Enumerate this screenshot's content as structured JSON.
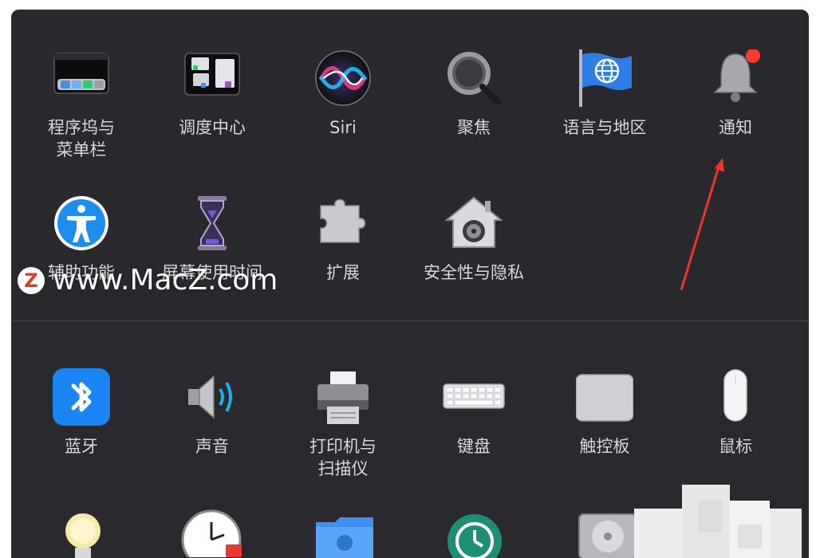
{
  "watermark": {
    "text": "www.MacZ.com",
    "badge": "Z"
  },
  "top_panes": [
    {
      "label": "程序坞与\n菜单栏",
      "icon": "dock-menubar-icon"
    },
    {
      "label": "调度中心",
      "icon": "mission-control-icon"
    },
    {
      "label": "Siri",
      "icon": "siri-icon"
    },
    {
      "label": "聚焦",
      "icon": "spotlight-icon"
    },
    {
      "label": "语言与地区",
      "icon": "language-region-flag-icon"
    },
    {
      "label": "通知",
      "icon": "notifications-bell-icon"
    },
    {
      "label": "辅助功能",
      "icon": "accessibility-icon"
    },
    {
      "label": "屏幕使用时间",
      "icon": "screen-time-hourglass-icon"
    },
    {
      "label": "扩展",
      "icon": "extensions-puzzle-icon"
    },
    {
      "label": "安全性与隐私",
      "icon": "security-privacy-house-icon"
    }
  ],
  "bottom_panes": [
    {
      "label": "蓝牙",
      "icon": "bluetooth-icon"
    },
    {
      "label": "声音",
      "icon": "sound-speaker-icon"
    },
    {
      "label": "打印机与\n扫描仪",
      "icon": "printer-scanner-icon"
    },
    {
      "label": "键盘",
      "icon": "keyboard-icon"
    },
    {
      "label": "触控板",
      "icon": "trackpad-icon"
    },
    {
      "label": "鼠标",
      "icon": "mouse-icon"
    }
  ],
  "partial_icons": [
    "energy-bulb-icon",
    "date-time-clock-icon",
    "sharing-folder-icon",
    "time-machine-icon",
    "startup-disk-icon"
  ],
  "colors": {
    "window_bg": "#29282d",
    "annotation_arrow": "#e8362c",
    "label": "#d8d8da"
  }
}
